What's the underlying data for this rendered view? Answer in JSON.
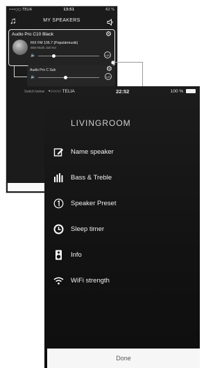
{
  "back_screen": {
    "status": {
      "carrier": "•••○○ TELIA",
      "time": "13:51",
      "battery": "62 %"
    },
    "nav_title": "MY SPEAKERS",
    "group": {
      "name": "Audio Pro C10 Black",
      "station": "RIX FM 106.7 (Populärmusik)",
      "subtitle": "Bäst Musik Just Nu!",
      "volume": 0.25,
      "lr_label": "L|R"
    },
    "sub_speaker": {
      "name": "Audio Pro C Sub",
      "volume": 0.45,
      "lr_label": "L|R"
    },
    "hint": "Switch between solo and multi mode?"
  },
  "front_screen": {
    "status": {
      "carrier": "•○○○○ TELIA",
      "time": "22:52",
      "battery": "100 %"
    },
    "room_title": "LIVINGROOM",
    "menu": [
      {
        "label": "Name speaker",
        "icon": "edit-icon"
      },
      {
        "label": "Bass & Treble",
        "icon": "equalizer-icon"
      },
      {
        "label": "Speaker Preset",
        "icon": "preset-number-icon"
      },
      {
        "label": "Sleep timer",
        "icon": "clock-icon"
      },
      {
        "label": "Info",
        "icon": "speaker-info-icon"
      },
      {
        "label": "WiFi strength",
        "icon": "wifi-icon"
      }
    ],
    "done_label": "Done"
  }
}
